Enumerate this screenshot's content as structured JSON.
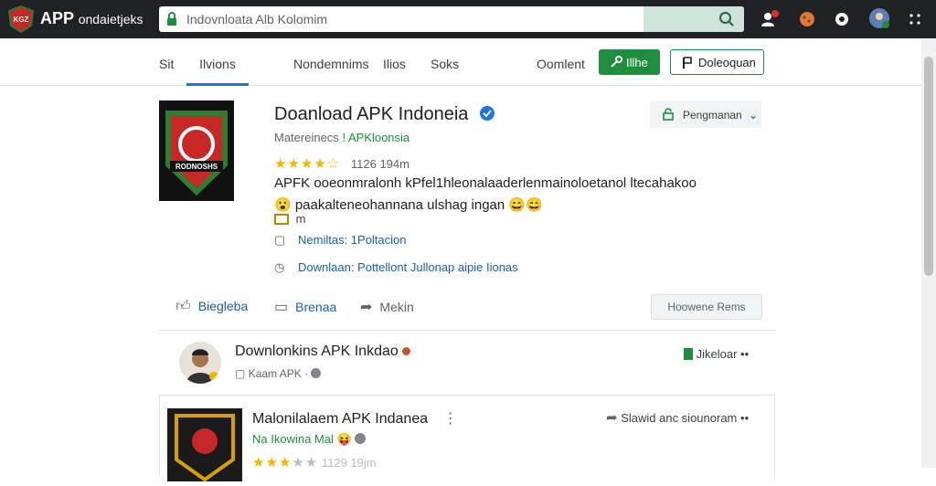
{
  "colors": {
    "topbar": "#202124",
    "accent_green": "#1e8e3e",
    "link_blue": "#1a5fa8",
    "star": "#f6b400"
  },
  "topbar": {
    "logo_text": "KGZ",
    "brand": "APP",
    "brand_sub": "ondaietjeks",
    "search_value": "Indovnloata Alb Kolomim",
    "icons": [
      "user-alert-icon",
      "cookie-icon",
      "settings-icon",
      "avatar-icon",
      "more-icon"
    ]
  },
  "nav": {
    "tabs": [
      "Sit",
      "Ilvions",
      "Nondemnims",
      "Ilios",
      "Soks"
    ],
    "omlent": "Oomlent",
    "primary_button": "Illhe",
    "secondary_button": "Doleoquan"
  },
  "card1": {
    "logo_text": "RODNOSHS",
    "title": "Doanload APK Indoneia",
    "subtitle_prefix": "Matereinecs",
    "subtitle_link": "! APKloonsia",
    "rating_text": "1126 194m",
    "rating_value": 4.5,
    "description": "APFK ooeonmralonh kPfel1hleonalaaderlenmainoloetanol ltecahakoo 😮 paakalteneohannana ulshag ingan 😄😄",
    "badge": "m",
    "info_1": "Nemiltas: 1Poltacion",
    "info_2": "Downlaan: Pottellont Jullonap aipie Iionas",
    "follow_button": "Pengmanan",
    "actions": {
      "like": "Biegleba",
      "comment": "Brenaa",
      "share": "Mekin",
      "right_button": "Hoowene Rems"
    }
  },
  "row2": {
    "title": "Downlonkins APK Inkdao",
    "sub": "Kaam APK",
    "action": "Jikeloar"
  },
  "card3": {
    "title": "Malonilalaem APK Indanea",
    "sub": "Na Ikowina Mal",
    "stars_text": "1129 19jm",
    "rating_value": 3.5,
    "action": "Slawid anc siounoram"
  }
}
